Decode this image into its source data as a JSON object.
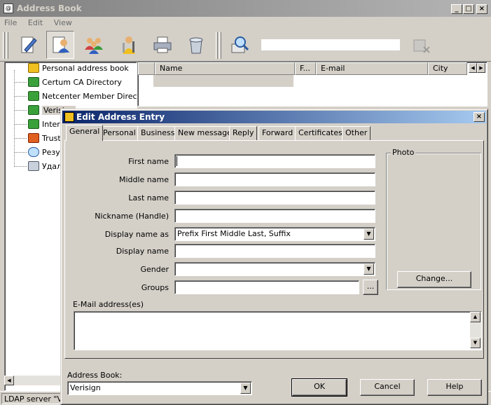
{
  "main_window": {
    "title": "Address Book",
    "menu": [
      "File",
      "Edit",
      "View"
    ],
    "toolbar_icons": [
      "new-contact-icon",
      "edit-contact-icon",
      "new-group-icon",
      "properties-icon",
      "print-icon",
      "delete-icon",
      "find-people-icon",
      "clear-search-icon"
    ],
    "search_value": ""
  },
  "tree": {
    "items": [
      {
        "label": "Personal address book",
        "icon": "address-book-icon"
      },
      {
        "label": "Certum CA Directory",
        "icon": "ldap-directory-icon"
      },
      {
        "label": "Netcenter Member Directory",
        "icon": "ldap-directory-icon"
      },
      {
        "label": "Verisign",
        "icon": "ldap-directory-icon"
      },
      {
        "label": "Intern",
        "icon": "ldap-directory-icon"
      },
      {
        "label": "Truste",
        "icon": "book-icon"
      },
      {
        "label": "Резул",
        "icon": "search-results-icon"
      },
      {
        "label": "Удал",
        "icon": "trash-icon"
      }
    ]
  },
  "list": {
    "columns": [
      "Name",
      "F...",
      "E-mail",
      "City"
    ]
  },
  "status": {
    "text": "LDAP server \"Ve"
  },
  "dialog": {
    "title": "Edit Address Entry",
    "tabs": [
      "General",
      "Personal",
      "Business",
      "New message",
      "Reply",
      "Forward",
      "Certificates",
      "Other"
    ],
    "active_tab": "General",
    "fields": {
      "first_name": {
        "label": "First name",
        "value": ""
      },
      "middle_name": {
        "label": "Middle name",
        "value": ""
      },
      "last_name": {
        "label": "Last name",
        "value": ""
      },
      "nickname": {
        "label": "Nickname (Handle)",
        "value": ""
      },
      "display_name_as": {
        "label": "Display name as",
        "value": "Prefix First Middle Last, Suffix"
      },
      "display_name": {
        "label": "Display name",
        "value": ""
      },
      "gender": {
        "label": "Gender",
        "value": ""
      },
      "groups": {
        "label": "Groups",
        "value": ""
      }
    },
    "groups_button": "...",
    "photo": {
      "caption": "Photo",
      "change_button": "Change..."
    },
    "email_label": "E-Mail address(es)",
    "address_book_label": "Address Book:",
    "address_book_value": "Verisign",
    "buttons": {
      "ok": "OK",
      "cancel": "Cancel",
      "help": "Help"
    }
  }
}
